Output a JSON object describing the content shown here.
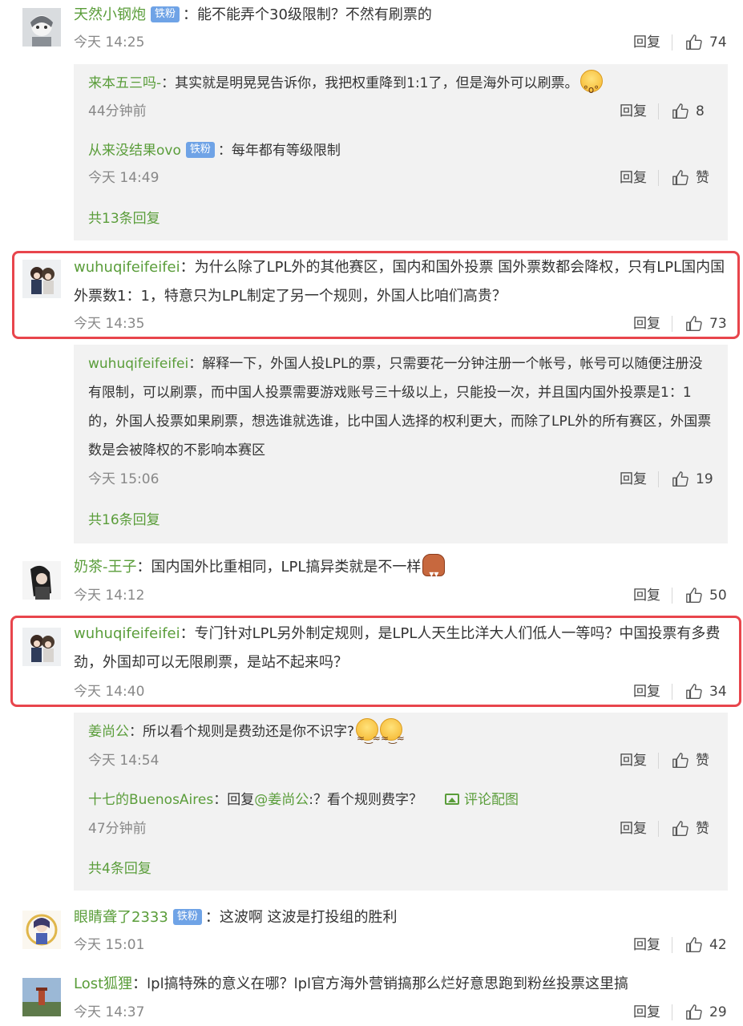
{
  "comments": [
    {
      "user": "天然小钢炮",
      "badge": "铁粉",
      "sep": "：",
      "text": "能不能弄个30级限制？不然有刷票的",
      "time": "今天 14:25",
      "reply_label": "回复",
      "likes": "74",
      "replies": [
        {
          "user": "来本五三吗-",
          "sep": "：",
          "text": "其实就是明晃晃告诉你，我把权重降到1:1了，但是海外可以刷票。",
          "emoji": "scared-face-icon",
          "time": "44分钟前",
          "reply_label": "回复",
          "likes": "8"
        },
        {
          "user": "从来没结果ovo",
          "badge": "铁粉",
          "sep": "：",
          "text": "每年都有等级限制",
          "time": "今天 14:49",
          "reply_label": "回复",
          "likes": "赞"
        }
      ],
      "more": "共13条回复"
    },
    {
      "user": "wuhuqifeifeifei",
      "sep": "：",
      "text": "为什么除了LPL外的其他赛区，国内和国外投票 国外票数都会降权，只有LPL国内国外票数1：1，特意只为LPL制定了另一个规则，外国人比咱们高贵？",
      "time": "今天 14:35",
      "reply_label": "回复",
      "likes": "73",
      "replies": [
        {
          "user": "wuhuqifeifeifei",
          "sep": "：",
          "text": "解释一下，外国人投LPL的票，只需要花一分钟注册一个帐号，帐号可以随便注册没有限制，可以刷票，而中国人投票需要游戏账号三十级以上，只能投一次，并且国内国外投票是1：1的，外国人投票如果刷票，想选谁就选谁，比中国人选择的权利更大，而除了LPL外的所有赛区，外国票数是会被降权的不影响本赛区",
          "time": "今天 15:06",
          "reply_label": "回复",
          "likes": "19"
        }
      ],
      "more": "共16条回复"
    },
    {
      "user": "奶茶-王子",
      "sep": "：",
      "text": "国内国外比重相同，LPL搞异类就是不一样",
      "emoji": "gingerbread-icon",
      "time": "今天 14:12",
      "reply_label": "回复",
      "likes": "50"
    },
    {
      "user": "wuhuqifeifeifei",
      "sep": "：",
      "text": "专门针对LPL另外制定规则，是LPL人天生比洋大人们低人一等吗？中国投票有多费劲，外国却可以无限刷票，是站不起来吗？",
      "time": "今天 14:40",
      "reply_label": "回复",
      "likes": "34",
      "replies": [
        {
          "user": "姜尚公",
          "sep": "：",
          "text": "所以看个规则是费劲还是你不识字?",
          "emoji": "dizzy-face-icon",
          "time": "今天 14:54",
          "reply_label": "回复",
          "likes": "赞"
        },
        {
          "user": "十七的BuenosAires",
          "sep": "：",
          "prefix": "回复",
          "mention": "@姜尚公",
          "text": ":？看个规则费字？",
          "pic_label": "评论配图",
          "time": "47分钟前",
          "reply_label": "回复",
          "likes": "赞"
        }
      ],
      "more": "共4条回复"
    },
    {
      "user": "眼睛聋了2333",
      "badge": "铁粉",
      "sep": "：",
      "text": "这波啊 这波是打投组的胜利",
      "time": "今天 15:01",
      "reply_label": "回复",
      "likes": "42"
    },
    {
      "user": "Lost狐狸",
      "sep": "：",
      "text": "lpl搞特殊的意义在哪？lpl官方海外营销搞那么烂好意思跑到粉丝投票这里搞",
      "time": "今天 14:37",
      "reply_label": "回复",
      "likes": "29"
    }
  ],
  "colors": {
    "username": "#5a9d3a",
    "badge": "#6fa3e6",
    "highlight": "#e8454c",
    "reply_bg": "#f2f2f2"
  }
}
